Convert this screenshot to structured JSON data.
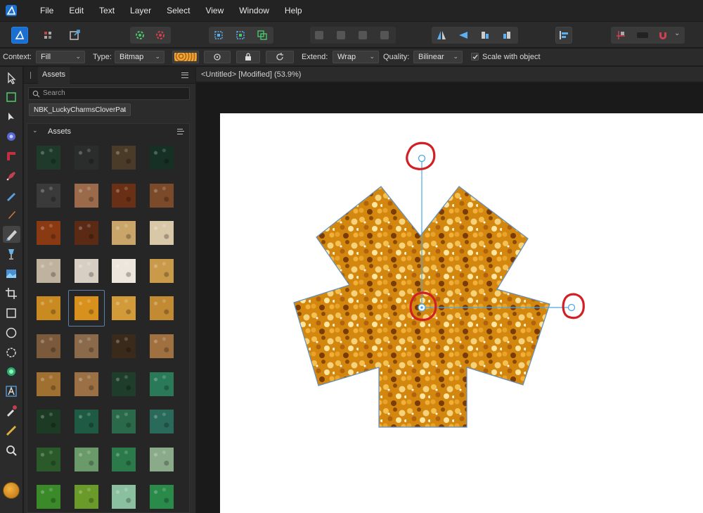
{
  "menu": {
    "items": [
      "File",
      "Edit",
      "Text",
      "Layer",
      "Select",
      "View",
      "Window",
      "Help"
    ]
  },
  "context_toolbar": {
    "context_label": "Context:",
    "context_value": "Fill",
    "type_label": "Type:",
    "type_value": "Bitmap",
    "extend_label": "Extend:",
    "extend_value": "Wrap",
    "quality_label": "Quality:",
    "quality_value": "Bilinear",
    "scale_label": "Scale with object",
    "scale_checked": true
  },
  "assets_panel": {
    "tab_label": "Assets",
    "search_placeholder": "Search",
    "category": "NBK_LuckyCharmsCloverPat",
    "section_title": "Assets",
    "selected_index": 17,
    "thumbnails": [
      [
        "#1f3a2a",
        "#2a2d2c",
        "#4a3a28",
        "#173025"
      ],
      [
        "#3a3a3a",
        "#9a6a4a",
        "#6a3015",
        "#7a4a2a"
      ],
      [
        "#8a3a12",
        "#5a2a15",
        "#c9a56a",
        "#d8c8a8"
      ],
      [
        "#bfb3a0",
        "#d8cfc4",
        "#ece6dc",
        "#c99a4a"
      ],
      [
        "#c98a22",
        "#d7911c",
        "#d39a3a",
        "#c28a32"
      ],
      [
        "#7a5a3a",
        "#8a6a4a",
        "#3a2a1a",
        "#a07040"
      ],
      [
        "#a07030",
        "#9a7044",
        "#1e3d2a",
        "#2a7a5a"
      ],
      [
        "#1c3a24",
        "#1e5a44",
        "#2a6a4a",
        "#2a6a5a"
      ],
      [
        "#2a5a2a",
        "#6a9a6a",
        "#2a7a4a",
        "#8aaa8a"
      ],
      [
        "#3a8a2a",
        "#6a9a2a",
        "#8ac0a0",
        "#2a8a4a"
      ]
    ]
  },
  "document": {
    "title": "<Untitled> [Modified] (53.9%)"
  },
  "colors": {
    "accent": "#4aa8e8",
    "fill_gold": "#d7911c",
    "annotation_red": "#d11f24"
  }
}
